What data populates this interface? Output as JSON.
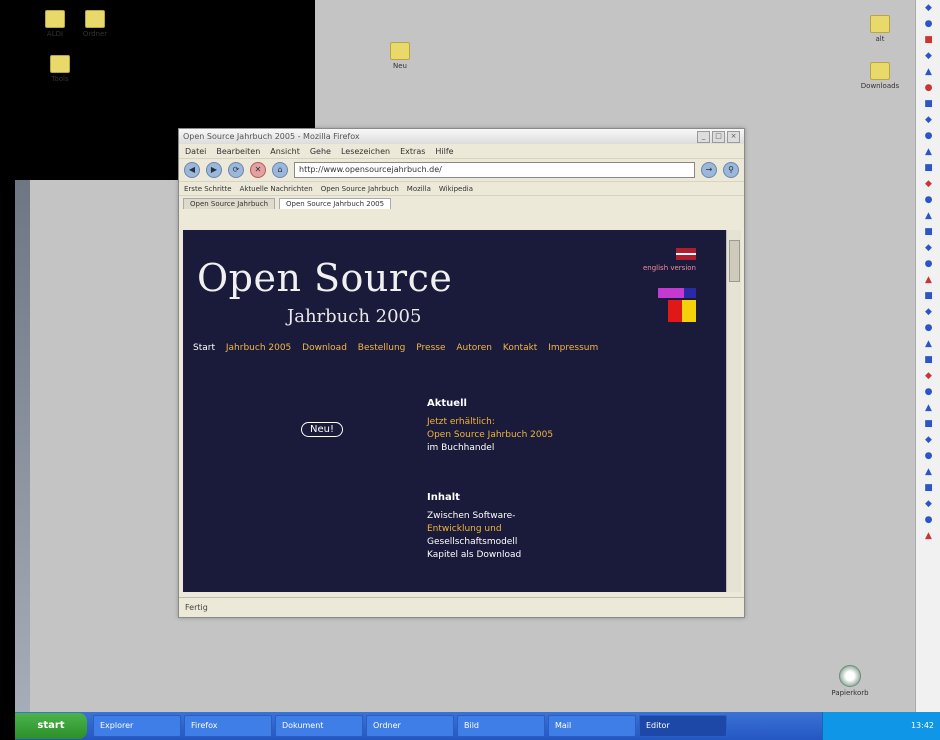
{
  "desktop": {
    "icons": [
      {
        "label": "ALDI"
      },
      {
        "label": "Ordner"
      },
      {
        "label": "Tools"
      },
      {
        "label": "Neu"
      },
      {
        "label": "alt"
      },
      {
        "label": "Downloads"
      }
    ],
    "recycle_bin": {
      "label": "Papierkorb"
    }
  },
  "browser": {
    "title": "Open Source Jahrbuch 2005 - Mozilla Firefox",
    "menu": [
      "Datei",
      "Bearbeiten",
      "Ansicht",
      "Gehe",
      "Lesezeichen",
      "Extras",
      "Hilfe"
    ],
    "nav": {
      "back": "◀",
      "forward": "▶",
      "reload": "⟳",
      "stop": "✕",
      "home": "⌂"
    },
    "url": "http://www.opensourcejahrbuch.de/",
    "bookmarks": [
      "Erste Schritte",
      "Aktuelle Nachrichten",
      "Open Source Jahrbuch",
      "Mozilla",
      "Wikipedia"
    ],
    "tabs": [
      {
        "label": "Open Source Jahrbuch"
      },
      {
        "label": "Open Source Jahrbuch 2005"
      }
    ],
    "status": "Fertig"
  },
  "site": {
    "title": "Open Source",
    "subtitle": "Jahrbuch 2005",
    "lang_link": "english version",
    "nav": [
      "Start",
      "Jahrbuch 2005",
      "Download",
      "Bestellung",
      "Presse",
      "Autoren",
      "Kontakt",
      "Impressum"
    ],
    "side_link": "Neu!",
    "section1": {
      "heading": "Aktuell",
      "rows": [
        "Jetzt erhältlich:",
        "Open Source Jahrbuch 2005",
        "im Buchhandel"
      ]
    },
    "section2": {
      "heading": "Inhalt",
      "rows": [
        "Zwischen Software-",
        "Entwicklung und",
        "Gesellschaftsmodell",
        "Kapitel als Download"
      ]
    }
  },
  "taskbar": {
    "start_label": "start",
    "tasks": [
      "Explorer",
      "Firefox",
      "Dokument",
      "Ordner",
      "Bild",
      "Mail",
      "Editor"
    ],
    "clock": "13:42"
  },
  "colors": {
    "site_background": "#1a1b3a",
    "link_orange": "#f0b43a",
    "taskbar_blue": "#2557c3"
  }
}
